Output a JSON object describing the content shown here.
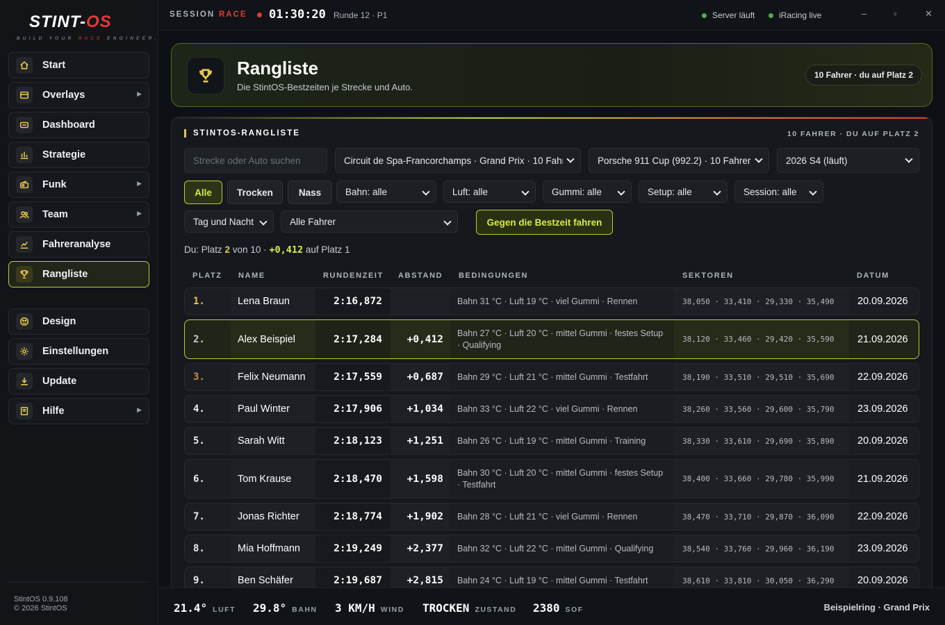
{
  "logo": {
    "brand_a": "STINT",
    "brand_b": "OS",
    "tagline_a": "BUILD YOUR ",
    "tagline_b": "RACE",
    "tagline_c": " ENGINEER."
  },
  "sidebar": {
    "items": [
      {
        "label": "Start",
        "icon": "home-icon"
      },
      {
        "label": "Overlays",
        "icon": "overlay-icon"
      },
      {
        "label": "Dashboard",
        "icon": "dashboard-icon"
      },
      {
        "label": "Strategie",
        "icon": "chart-bars-icon"
      },
      {
        "label": "Funk",
        "icon": "radio-icon"
      },
      {
        "label": "Team",
        "icon": "team-icon"
      },
      {
        "label": "Fahreranalyse",
        "icon": "trend-icon"
      },
      {
        "label": "Rangliste",
        "icon": "trophy-icon"
      },
      {
        "label": "Design",
        "icon": "palette-icon"
      },
      {
        "label": "Einstellungen",
        "icon": "gear-icon"
      },
      {
        "label": "Update",
        "icon": "download-icon"
      },
      {
        "label": "Hilfe",
        "icon": "book-icon"
      }
    ],
    "version": "StintOS 0.9.108",
    "copyright": "© 2026 StintOS"
  },
  "topbar": {
    "session_label": "SESSION",
    "session_type": "RACE",
    "clock": "01:30:20",
    "lap": "Runde 12 · P1",
    "server_status": "Server läuft",
    "sim_status": "iRacing live",
    "minimize": "–",
    "maximize": "▫",
    "close": "✕"
  },
  "hero": {
    "title": "Rangliste",
    "subtitle": "Die StintOS-Bestzeiten je Strecke und Auto.",
    "badge": "10 Fahrer · du auf Platz 2"
  },
  "panel": {
    "title": "STINTOS-RANGLISTE",
    "right": "10 FAHRER · DU AUF PLATZ 2",
    "search_placeholder": "Strecke oder Auto suchen",
    "track_select": "Circuit de Spa-Francorchamps · Grand Prix · 10 Fahrer",
    "car_select": "Porsche 911 Cup (992.2) · 10 Fahrer",
    "season_select": "2026 S4 (läuft)",
    "chips": [
      "Alle",
      "Trocken",
      "Nass"
    ],
    "filters": [
      "Bahn: alle",
      "Luft: alle",
      "Gummi: alle",
      "Setup: alle",
      "Session: alle"
    ],
    "daytime_select": "Tag und Nacht",
    "driver_select": "Alle Fahrer",
    "best_button": "Gegen die Bestzeit fahren",
    "summary_a": "Du: Platz ",
    "summary_pos": "2",
    "summary_b": " von 10 · ",
    "summary_gap": "+0,412",
    "summary_c": " auf Platz 1"
  },
  "table": {
    "headers": [
      "PLATZ",
      "NAME",
      "RUNDENZEIT",
      "ABSTAND",
      "BEDINGUNGEN",
      "SEKTOREN",
      "DATUM"
    ],
    "rows": [
      {
        "pos": "1.",
        "name": "Lena Braun",
        "time": "2:16,872",
        "gap": "",
        "cond": "Bahn 31 °C · Luft 19 °C · viel Gummi · Rennen",
        "sectors": "38,050 · 33,410 · 29,330 · 35,490",
        "date": "20.09.2026"
      },
      {
        "pos": "2.",
        "name": "Alex Beispiel",
        "time": "2:17,284",
        "gap": "+0,412",
        "cond": "Bahn 27 °C · Luft 20 °C · mittel Gummi · festes Setup · Qualifying",
        "sectors": "38,120 · 33,460 · 29,420 · 35,590",
        "date": "21.09.2026"
      },
      {
        "pos": "3.",
        "name": "Felix Neumann",
        "time": "2:17,559",
        "gap": "+0,687",
        "cond": "Bahn 29 °C · Luft 21 °C · mittel Gummi · Testfahrt",
        "sectors": "38,190 · 33,510 · 29,510 · 35,690",
        "date": "22.09.2026"
      },
      {
        "pos": "4.",
        "name": "Paul Winter",
        "time": "2:17,906",
        "gap": "+1,034",
        "cond": "Bahn 33 °C · Luft 22 °C · viel Gummi · Rennen",
        "sectors": "38,260 · 33,560 · 29,600 · 35,790",
        "date": "23.09.2026"
      },
      {
        "pos": "5.",
        "name": "Sarah Witt",
        "time": "2:18,123",
        "gap": "+1,251",
        "cond": "Bahn 26 °C · Luft 19 °C · mittel Gummi · Training",
        "sectors": "38,330 · 33,610 · 29,690 · 35,890",
        "date": "20.09.2026"
      },
      {
        "pos": "6.",
        "name": "Tom Krause",
        "time": "2:18,470",
        "gap": "+1,598",
        "cond": "Bahn 30 °C · Luft 20 °C · mittel Gummi · festes Setup · Testfahrt",
        "sectors": "38,400 · 33,660 · 29,780 · 35,990",
        "date": "21.09.2026"
      },
      {
        "pos": "7.",
        "name": "Jonas Richter",
        "time": "2:18,774",
        "gap": "+1,902",
        "cond": "Bahn 28 °C · Luft 21 °C · viel Gummi · Rennen",
        "sectors": "38,470 · 33,710 · 29,870 · 36,090",
        "date": "22.09.2026"
      },
      {
        "pos": "8.",
        "name": "Mia Hoffmann",
        "time": "2:19,249",
        "gap": "+2,377",
        "cond": "Bahn 32 °C · Luft 22 °C · mittel Gummi · Qualifying",
        "sectors": "38,540 · 33,760 · 29,960 · 36,190",
        "date": "23.09.2026"
      },
      {
        "pos": "9.",
        "name": "Ben Schäfer",
        "time": "2:19,687",
        "gap": "+2,815",
        "cond": "Bahn 24 °C · Luft 19 °C · mittel Gummi · Testfahrt",
        "sectors": "38,610 · 33,810 · 30,050 · 36,290",
        "date": "20.09.2026"
      }
    ]
  },
  "bottombar": {
    "air_value": "21.4°",
    "air_label": "LUFT",
    "track_value": "29.8°",
    "track_label": "BAHN",
    "wind_value": "3 KM/H",
    "wind_label": "WIND",
    "cond_value": "TROCKEN",
    "cond_label": "ZUSTAND",
    "sof_value": "2380",
    "sof_label": "SOF",
    "track_name": "Beispielring · Grand Prix"
  },
  "colors": {
    "accent": "#b8cf32",
    "gold": "#e8c64a",
    "red": "#e53935",
    "bg": "#0d1014"
  }
}
